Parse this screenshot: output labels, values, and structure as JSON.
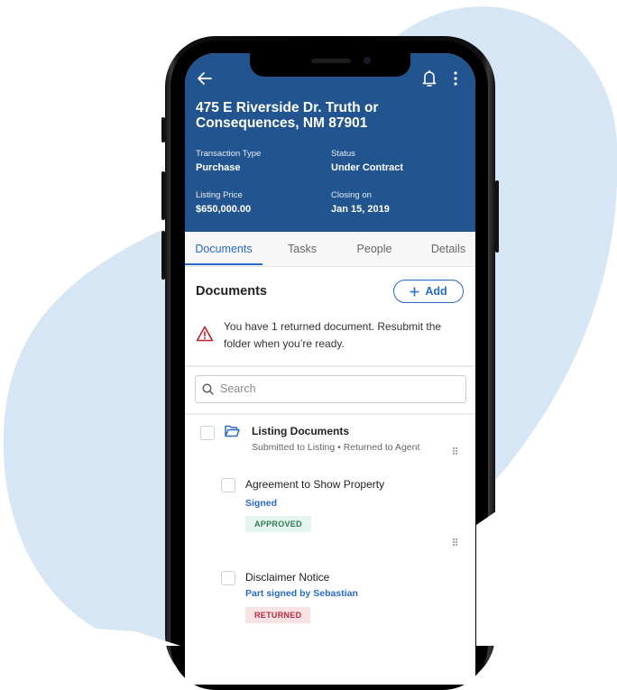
{
  "colors": {
    "header_bg": "#22558f",
    "accent": "#2a6ac8",
    "blob": "#d6e6f5",
    "alert": "#c0202e",
    "approved_bg": "#e6f4ee",
    "approved_fg": "#2e7d4f",
    "returned_bg": "#f7e2e4",
    "returned_fg": "#b72b3a"
  },
  "header": {
    "back_icon": "arrow-left-icon",
    "bell_icon": "bell-icon",
    "more_icon": "more-vertical-icon",
    "address": "475 E Riverside Dr. Truth or Consequences, NM 87901",
    "fields": [
      {
        "label": "Transaction Type",
        "value": "Purchase"
      },
      {
        "label": "Status",
        "value": "Under Contract"
      },
      {
        "label": "Listing Price",
        "value": "$650,000.00"
      },
      {
        "label": "Closing on",
        "value": "Jan 15, 2019"
      }
    ]
  },
  "tabs": [
    {
      "label": "Documents",
      "active": true
    },
    {
      "label": "Tasks",
      "active": false
    },
    {
      "label": "People",
      "active": false
    },
    {
      "label": "Details",
      "active": false
    }
  ],
  "documents": {
    "title": "Documents",
    "add_label": "Add",
    "alert_text": "You have 1 returned document. Resubmit the folder when you’re ready.",
    "search_placeholder": "Search",
    "folder": {
      "title": "Listing Documents",
      "subtitle": "Submitted to Listing • Returned to Agent"
    },
    "items": [
      {
        "title": "Agreement to Show Property",
        "status": "Signed",
        "badge": "APPROVED"
      },
      {
        "title": "Disclaimer Notice",
        "status": "Part signed by Sebastian",
        "badge": "RETURNED"
      }
    ]
  }
}
